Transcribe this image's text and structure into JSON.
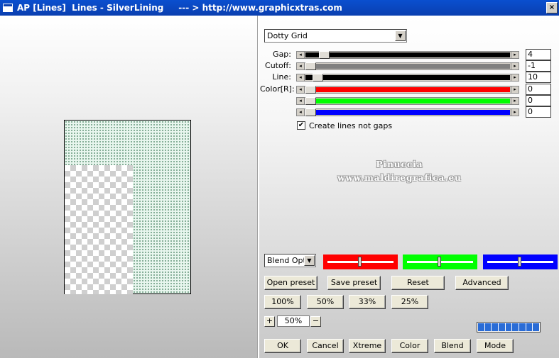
{
  "window": {
    "title": "AP [Lines]  Lines - SilverLining     --- > http://www.graphicxtras.com"
  },
  "preset_select": {
    "value": "Dotty Grid"
  },
  "sliders": [
    {
      "label": "Gap:",
      "value": "4",
      "color": "#000000",
      "thumb": 0.07
    },
    {
      "label": "Cutoff:",
      "value": "-1",
      "color": "#808080",
      "thumb": 0.0
    },
    {
      "label": "Line:",
      "value": "10",
      "color": "#000000",
      "thumb": 0.035
    },
    {
      "label": "Color[R]:",
      "value": "0",
      "color": "#ff0000",
      "thumb": 0.0
    },
    {
      "label": "",
      "value": "0",
      "color": "#00ff00",
      "thumb": 0.0
    },
    {
      "label": "",
      "value": "0",
      "color": "#0000ff",
      "thumb": 0.0
    }
  ],
  "checkbox": {
    "label": "Create lines not gaps",
    "checked": true,
    "mark": "✔"
  },
  "watermark": {
    "line1": "Pinuccia",
    "line2": "www.maldiregrafica.eu"
  },
  "blend_select": {
    "value": "Blend Optio"
  },
  "color_sliders": [
    {
      "color": "#ff0000",
      "knob": 0.5
    },
    {
      "color": "#00ff00",
      "knob": 0.5
    },
    {
      "color": "#0000ff",
      "knob": 0.5
    }
  ],
  "buttons": {
    "open_preset": "Open preset",
    "save_preset": "Save preset",
    "reset": "Reset",
    "advanced": "Advanced",
    "z100": "100%",
    "z50": "50%",
    "z33": "33%",
    "z25": "25%",
    "ok": "OK",
    "cancel": "Cancel",
    "xtreme": "Xtreme",
    "color": "Color",
    "blend": "Blend",
    "mode": "Mode"
  },
  "zoom": {
    "plus": "+",
    "minus": "−",
    "value": "50%"
  },
  "icons": {
    "close": "×",
    "arrow_down": "▼",
    "arrow_left": "◂",
    "arrow_right": "▸"
  }
}
